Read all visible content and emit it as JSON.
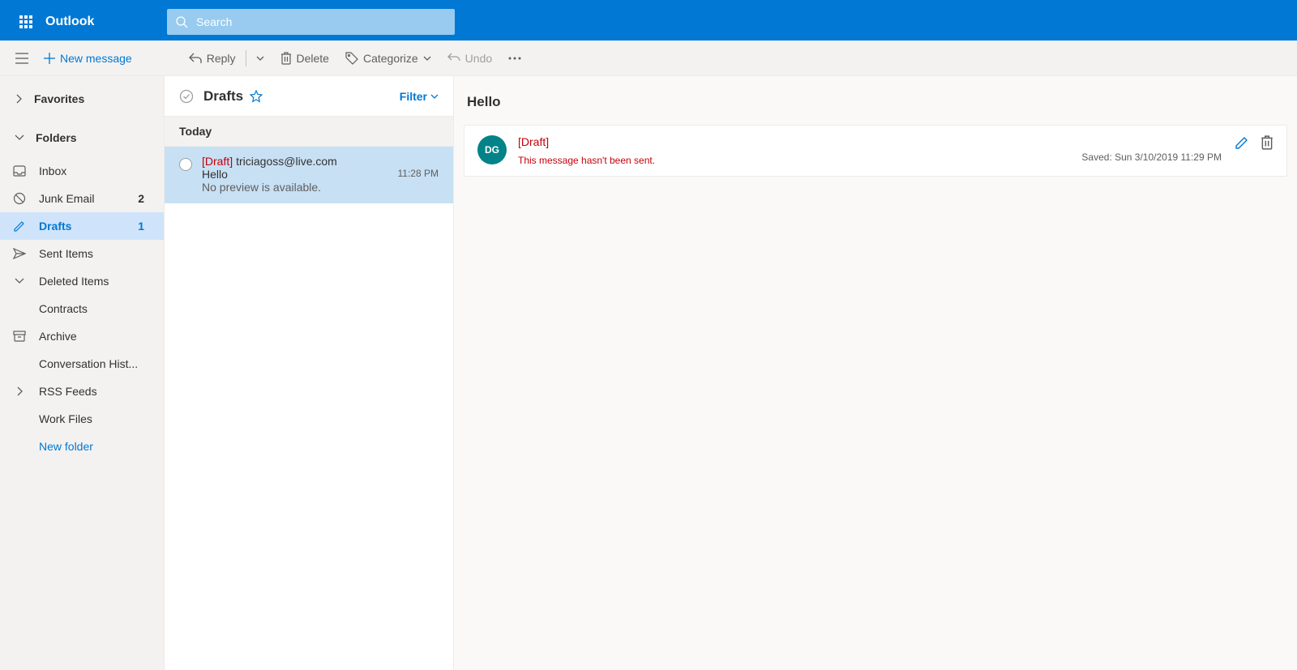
{
  "brand": "Outlook",
  "search": {
    "placeholder": "Search"
  },
  "toolbar": {
    "new_message": "New message",
    "reply": "Reply",
    "delete": "Delete",
    "categorize": "Categorize",
    "undo": "Undo"
  },
  "sidebar": {
    "favorites": "Favorites",
    "folders_label": "Folders",
    "folders": [
      {
        "icon": "inbox",
        "label": "Inbox",
        "count": ""
      },
      {
        "icon": "junk",
        "label": "Junk Email",
        "count": "2"
      },
      {
        "icon": "drafts",
        "label": "Drafts",
        "count": "1",
        "selected": true
      },
      {
        "icon": "sent",
        "label": "Sent Items",
        "count": ""
      },
      {
        "icon": "deleted",
        "label": "Deleted Items",
        "count": "",
        "expandable": true
      },
      {
        "icon": "",
        "label": "Contracts",
        "count": "",
        "sub": true
      },
      {
        "icon": "archive",
        "label": "Archive",
        "count": ""
      },
      {
        "icon": "",
        "label": "Conversation Hist...",
        "count": ""
      },
      {
        "icon": "rss",
        "label": "RSS Feeds",
        "count": "",
        "expandable_right": true
      },
      {
        "icon": "",
        "label": "Work Files",
        "count": ""
      }
    ],
    "new_folder": "New folder"
  },
  "list": {
    "title": "Drafts",
    "filter": "Filter",
    "group": "Today",
    "items": [
      {
        "draft_label": "[Draft]",
        "to": "triciagoss@live.com",
        "subject": "Hello",
        "time": "11:28 PM",
        "preview": "No preview is available."
      }
    ]
  },
  "reading": {
    "subject": "Hello",
    "avatar_initials": "DG",
    "draft_label": "[Draft]",
    "not_sent": "This message hasn't been sent.",
    "saved": "Saved: Sun 3/10/2019 11:29 PM"
  }
}
